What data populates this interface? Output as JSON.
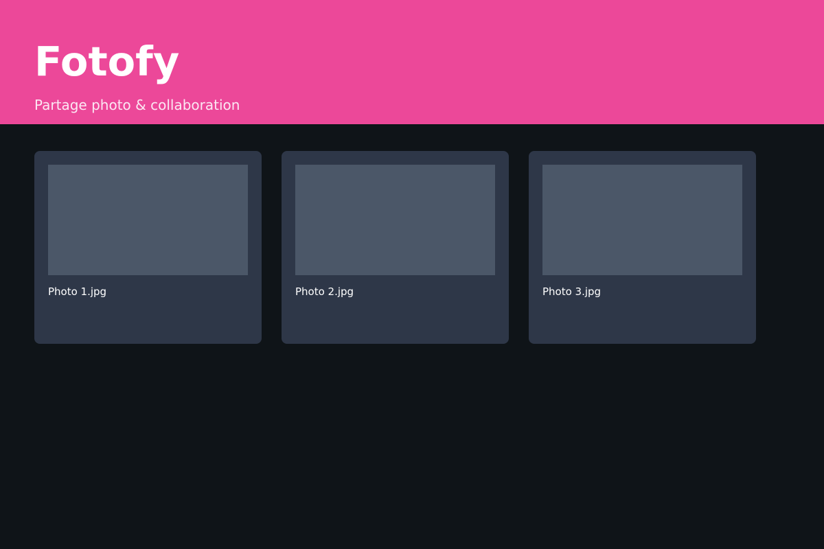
{
  "header": {
    "title": "Fotofy",
    "subtitle": "Partage photo & collaboration"
  },
  "photos": [
    {
      "name": "Photo 1.jpg"
    },
    {
      "name": "Photo 2.jpg"
    },
    {
      "name": "Photo 3.jpg"
    }
  ],
  "colors": {
    "brand": "#ec4899",
    "background": "#0f1418",
    "card": "#2e3748",
    "thumbnail": "#4b5768"
  }
}
